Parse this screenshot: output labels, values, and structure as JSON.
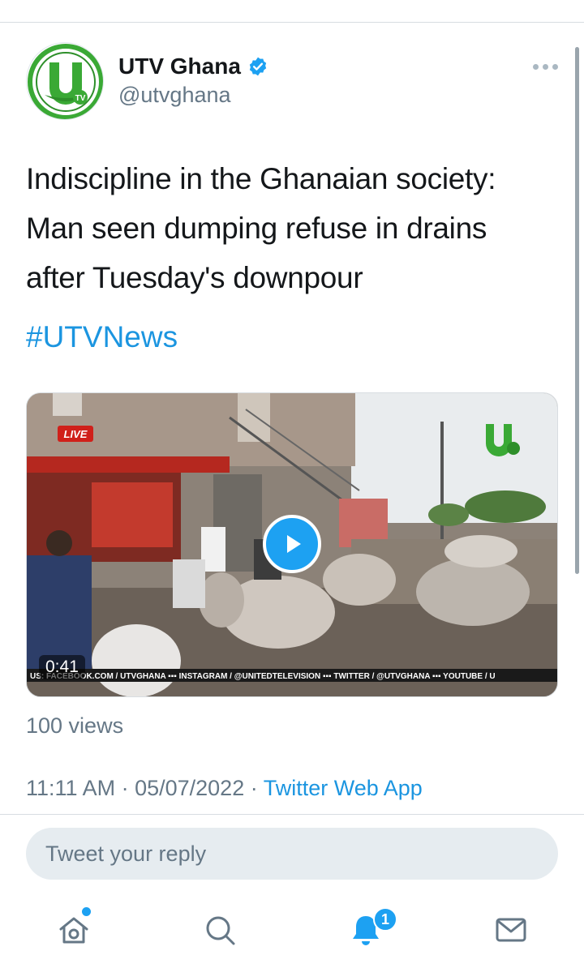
{
  "author": {
    "name": "UTV Ghana",
    "handle": "@utvghana",
    "verified": true,
    "logo_letter": "U",
    "logo_subtext": "TV"
  },
  "tweet": {
    "text": "Indiscipline in the Ghanaian society: Man seen dumping refuse in drains after Tuesday's downpour",
    "hashtag": "#UTVNews"
  },
  "media": {
    "type": "video",
    "duration": "0:41",
    "live_label": "LIVE",
    "ticker": "US: FACEBOOK.COM / UTVGHANA  ▪▪▪ INSTAGRAM / @UNITEDTELEVISION  ▪▪▪ TWITTER / @UTVGHANA ▪▪▪ YOUTUBE / U"
  },
  "stats": {
    "views": "100 views"
  },
  "meta": {
    "time": "11:11 AM",
    "separator": " · ",
    "date": "05/07/2022",
    "source": "Twitter Web App"
  },
  "reply": {
    "placeholder": "Tweet your reply"
  },
  "tabbar": {
    "items": [
      {
        "icon": "home-icon",
        "has_dot": true
      },
      {
        "icon": "search-icon"
      },
      {
        "icon": "notifications-icon",
        "badge": "1"
      },
      {
        "icon": "messages-icon"
      }
    ]
  },
  "colors": {
    "accent": "#1da1f2",
    "link": "#1b95e0",
    "secondary_text": "#657786",
    "logo_green": "#3aa935"
  }
}
